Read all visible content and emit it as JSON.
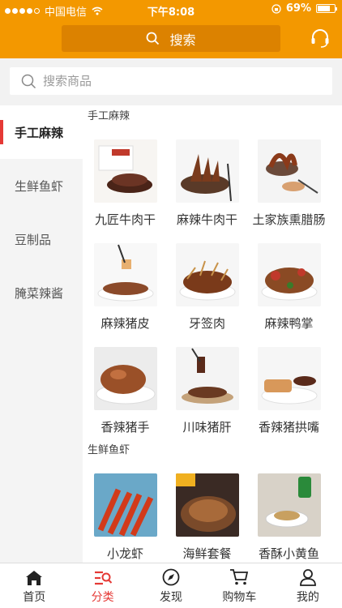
{
  "status_bar": {
    "carrier": "中国电信",
    "time": "下午8:08",
    "battery": "69%"
  },
  "header": {
    "search_label": "搜索"
  },
  "search": {
    "placeholder": "搜索商品"
  },
  "sidebar": {
    "items": [
      {
        "label": "手工麻辣"
      },
      {
        "label": "生鲜鱼虾"
      },
      {
        "label": "豆制品"
      },
      {
        "label": "腌菜辣酱"
      }
    ]
  },
  "sections": [
    {
      "title": "手工麻辣",
      "products": [
        {
          "name": "九匠牛肉干"
        },
        {
          "name": "麻辣牛肉干"
        },
        {
          "name": "土家族熏腊肠"
        },
        {
          "name": "麻辣猪皮"
        },
        {
          "name": "牙签肉"
        },
        {
          "name": "麻辣鸭掌"
        },
        {
          "name": "香辣猪手"
        },
        {
          "name": "川味猪肝"
        },
        {
          "name": "香辣猪拱嘴"
        }
      ]
    },
    {
      "title": "生鲜鱼虾",
      "products": [
        {
          "name": "小龙虾"
        },
        {
          "name": "海鲜套餐"
        },
        {
          "name": "香酥小黄鱼"
        }
      ]
    }
  ],
  "tabbar": {
    "tabs": [
      {
        "label": "首页",
        "icon": "home-icon"
      },
      {
        "label": "分类",
        "icon": "category-icon"
      },
      {
        "label": "发现",
        "icon": "compass-icon"
      },
      {
        "label": "购物车",
        "icon": "cart-icon"
      },
      {
        "label": "我的",
        "icon": "user-icon"
      }
    ]
  },
  "colors": {
    "brand": "#f39800",
    "accent": "#e53935"
  }
}
